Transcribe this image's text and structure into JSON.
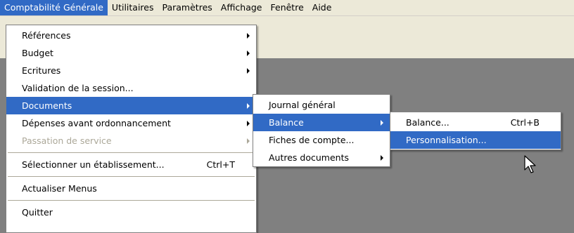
{
  "menubar": {
    "items": [
      "Comptabilité Générale",
      "Utilitaires",
      "Paramètres",
      "Affichage",
      "Fenêtre",
      "Aide"
    ]
  },
  "main_menu": {
    "items": [
      {
        "label": "Références"
      },
      {
        "label": "Budget"
      },
      {
        "label": "Ecritures"
      },
      {
        "label": "Validation de la session..."
      },
      {
        "label": "Documents"
      },
      {
        "label": "Dépenses avant ordonnancement"
      },
      {
        "label": "Passation de service"
      },
      {
        "label": "Sélectionner un établissement...",
        "shortcut": "Ctrl+T"
      },
      {
        "label": "Actualiser Menus"
      },
      {
        "label": "Quitter"
      }
    ]
  },
  "documents_menu": {
    "items": [
      {
        "label": "Journal général"
      },
      {
        "label": "Balance"
      },
      {
        "label": "Fiches de compte..."
      },
      {
        "label": "Autres documents"
      }
    ]
  },
  "balance_menu": {
    "items": [
      {
        "label": "Balance...",
        "shortcut": "Ctrl+B"
      },
      {
        "label": "Personnalisation..."
      }
    ]
  },
  "colors": {
    "highlight": "#316ac5",
    "workspace": "#808080",
    "menubar_bg": "#ece9d8",
    "disabled_text": "#aca899"
  }
}
